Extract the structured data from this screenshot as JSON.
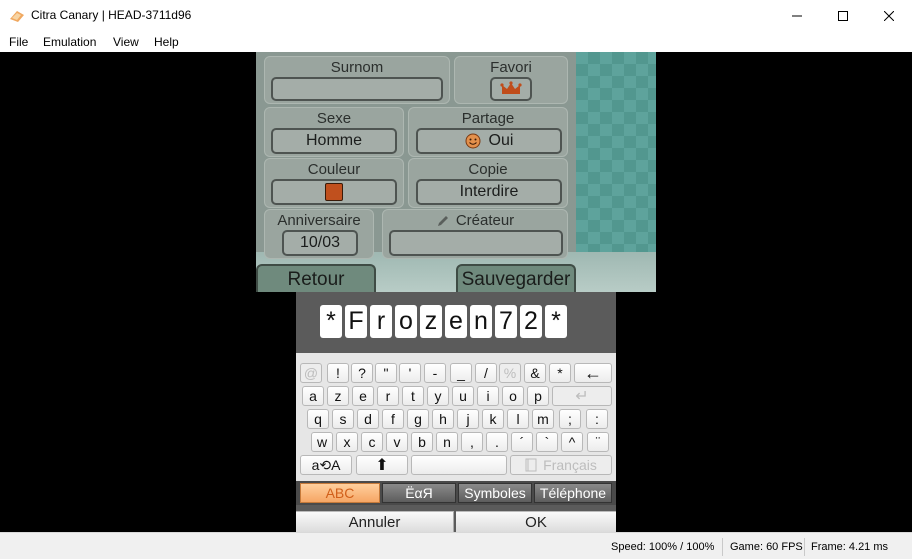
{
  "window": {
    "title": "Citra Canary | HEAD-3711d96",
    "controls": {
      "minimize": "minimize-icon",
      "maximize": "maximize-icon",
      "close": "close-icon"
    }
  },
  "menu": [
    "File",
    "Emulation",
    "View",
    "Help"
  ],
  "top_screen": {
    "surnom_label": "Surnom",
    "surnom_value": "",
    "favori_label": "Favori",
    "sexe_label": "Sexe",
    "sexe_value": "Homme",
    "partage_label": "Partage",
    "partage_value": "Oui",
    "couleur_label": "Couleur",
    "couleur_swatch": "#c0501e",
    "copie_label": "Copie",
    "copie_value": "Interdire",
    "anniversaire_label": "Anniversaire",
    "anniversaire_value": "10/03",
    "createur_label": "Créateur",
    "createur_value": "",
    "retour": "Retour",
    "sauvegarder": "Sauvegarder"
  },
  "bottom_screen": {
    "name_chars": [
      "*",
      "F",
      "r",
      "o",
      "z",
      "e",
      "n",
      "7",
      "2",
      "*"
    ],
    "keyboard": {
      "row1": [
        "@",
        "!",
        "?",
        "\"",
        "'",
        "-",
        "_",
        "/",
        "%",
        "&",
        "*",
        "←"
      ],
      "row2": [
        "a",
        "z",
        "e",
        "r",
        "t",
        "y",
        "u",
        "i",
        "o",
        "p",
        "↵"
      ],
      "row3": [
        "q",
        "s",
        "d",
        "f",
        "g",
        "h",
        "j",
        "k",
        "l",
        "m",
        ";",
        ":"
      ],
      "row4": [
        "w",
        "x",
        "c",
        "v",
        "b",
        "n",
        ",",
        ".",
        "´",
        "`",
        "^",
        "¨"
      ],
      "row5": {
        "case": "a⟲A",
        "shift": "⬆",
        "space": "",
        "lang": "Français"
      }
    },
    "modes": [
      "ABC",
      "ËαЯ",
      "Symboles",
      "Téléphone"
    ],
    "active_mode": "ABC",
    "cancel": "Annuler",
    "ok": "OK"
  },
  "status": {
    "speed": "Speed: 100% / 100%",
    "game": "Game: 60 FPS",
    "frame": "Frame: 4.21 ms"
  }
}
